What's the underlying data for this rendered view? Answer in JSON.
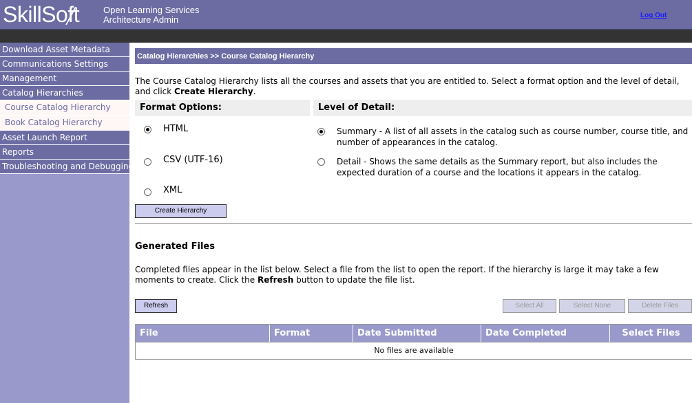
{
  "header": {
    "logo": "SkillSoft",
    "logo_parts": [
      "SkillS",
      "o",
      "ft"
    ],
    "tagline_line1": "Open Learning Services",
    "tagline_line2": "Architecture Admin",
    "logout": "Log Out"
  },
  "sidebar": {
    "items": [
      {
        "label": "Download Asset Metadata"
      },
      {
        "label": "Communications Settings"
      },
      {
        "label": "Management"
      },
      {
        "label": "Catalog Hierarchies"
      },
      {
        "label": "Course Catalog Hierarchy"
      },
      {
        "label": "Book Catalog Hierarchy"
      },
      {
        "label": "Asset Launch Report"
      },
      {
        "label": "Reports"
      },
      {
        "label": "Troubleshooting and Debugging"
      }
    ]
  },
  "breadcrumb": "Catalog Hierarchies >> Course Catalog Hierarchy",
  "intro": {
    "text": "The Course Catalog Hierarchy lists all the courses and assets that you are entitled to. Select a format option and the level of detail, and click ",
    "bold": "Create Hierarchy",
    "end": "."
  },
  "format_options": {
    "title": "Format Options:",
    "options": [
      {
        "label": "HTML",
        "selected": true
      },
      {
        "label": "CSV (UTF-16)",
        "selected": false
      },
      {
        "label": "XML",
        "selected": false
      }
    ]
  },
  "level_of_detail": {
    "title": "Level of Detail:",
    "options": [
      {
        "label": "Summary - A list of all assets in the catalog such as course number, course title, and number of appearances in the catalog.",
        "selected": true
      },
      {
        "label": "Detail - Shows the same details as the Summary report, but also includes the expected duration of a course and the locations it appears in the catalog.",
        "selected": false
      }
    ]
  },
  "create_button": "Create Hierarchy",
  "generated": {
    "title": "Generated Files",
    "text1": "Completed files appear in the list below. Select a file from the list to open the report. If the hierarchy is large it may take a few moments to create. Click the ",
    "bold": "Refresh",
    "text2": " button to update the file list."
  },
  "buttons": {
    "refresh": "Refresh",
    "select_all": "Select All",
    "select_none": "Select None",
    "delete_files": "Delete Files"
  },
  "table": {
    "columns": [
      "File",
      "Format",
      "Date Submitted",
      "Date Completed",
      "Select Files"
    ],
    "empty": "No files are available"
  },
  "colors": {
    "header": "#6c6ca3",
    "sidebar": "#9999cc",
    "button": "#ccccee"
  }
}
